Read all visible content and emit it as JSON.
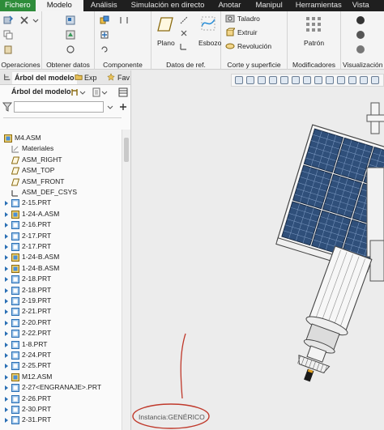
{
  "menu": [
    "Fichero",
    "Modelo",
    "Análisis",
    "Simulación en directo",
    "Anotar",
    "Manipul",
    "Herramientas",
    "Vista"
  ],
  "ribbon": {
    "groups": {
      "operaciones": "Operaciones",
      "obtener_datos": "Obtener datos",
      "componente": "Componente",
      "datos_ref": "Datos de ref.",
      "corte_superficie": "Corte y superficie",
      "modificadores": "Modificadores",
      "visualizacion": "Visualización"
    },
    "tools": {
      "plano": "Plano",
      "esbozo": "Esbozo",
      "taladro": "Taladro",
      "extruir": "Extruir",
      "revolucion": "Revolución",
      "patron": "Patrón"
    }
  },
  "left_pane": {
    "tabs": {
      "arbol": "Árbol del modelo",
      "exp": "Exp",
      "fav": "Fav"
    },
    "tree_label": "Árbol del modelo",
    "search_placeholder": "",
    "root": "M4.ASM",
    "items": [
      {
        "label": "Materiales",
        "kind": "mat",
        "toggle": false
      },
      {
        "label": "ASM_RIGHT",
        "kind": "datum",
        "toggle": false
      },
      {
        "label": "ASM_TOP",
        "kind": "datum",
        "toggle": false
      },
      {
        "label": "ASM_FRONT",
        "kind": "datum",
        "toggle": false
      },
      {
        "label": "ASM_DEF_CSYS",
        "kind": "csys",
        "toggle": false
      },
      {
        "label": "2-15.PRT",
        "kind": "prt",
        "toggle": true
      },
      {
        "label": "1-24-A.ASM",
        "kind": "asm",
        "toggle": true
      },
      {
        "label": "2-16.PRT",
        "kind": "prt",
        "toggle": true
      },
      {
        "label": "2-17.PRT",
        "kind": "prt",
        "toggle": true
      },
      {
        "label": "2-17.PRT",
        "kind": "prt",
        "toggle": true
      },
      {
        "label": "1-24-B.ASM",
        "kind": "asm",
        "toggle": true
      },
      {
        "label": "1-24-B.ASM",
        "kind": "asm",
        "toggle": true
      },
      {
        "label": "2-18.PRT",
        "kind": "prt",
        "toggle": true
      },
      {
        "label": "2-18.PRT",
        "kind": "prt",
        "toggle": true
      },
      {
        "label": "2-19.PRT",
        "kind": "prt",
        "toggle": true
      },
      {
        "label": "2-21.PRT",
        "kind": "prt",
        "toggle": true
      },
      {
        "label": "2-20.PRT",
        "kind": "prt",
        "toggle": true
      },
      {
        "label": "2-22.PRT",
        "kind": "prt",
        "toggle": true
      },
      {
        "label": "1-8.PRT",
        "kind": "prt",
        "toggle": true
      },
      {
        "label": "2-24.PRT",
        "kind": "prt",
        "toggle": true
      },
      {
        "label": "2-25.PRT",
        "kind": "prt",
        "toggle": true
      },
      {
        "label": "M12.ASM",
        "kind": "asm",
        "toggle": true
      },
      {
        "label": "2-27<ENGRANAJE>.PRT",
        "kind": "prt",
        "toggle": true
      },
      {
        "label": "2-26.PRT",
        "kind": "prt",
        "toggle": true
      },
      {
        "label": "2-30.PRT",
        "kind": "prt",
        "toggle": true
      },
      {
        "label": "2-31.PRT",
        "kind": "prt",
        "toggle": true
      }
    ]
  },
  "viewport": {
    "instance_text": "Instancia:GENÉRICO",
    "annotation_color": "#c0392b",
    "panel_color": "#2f4f7a"
  }
}
